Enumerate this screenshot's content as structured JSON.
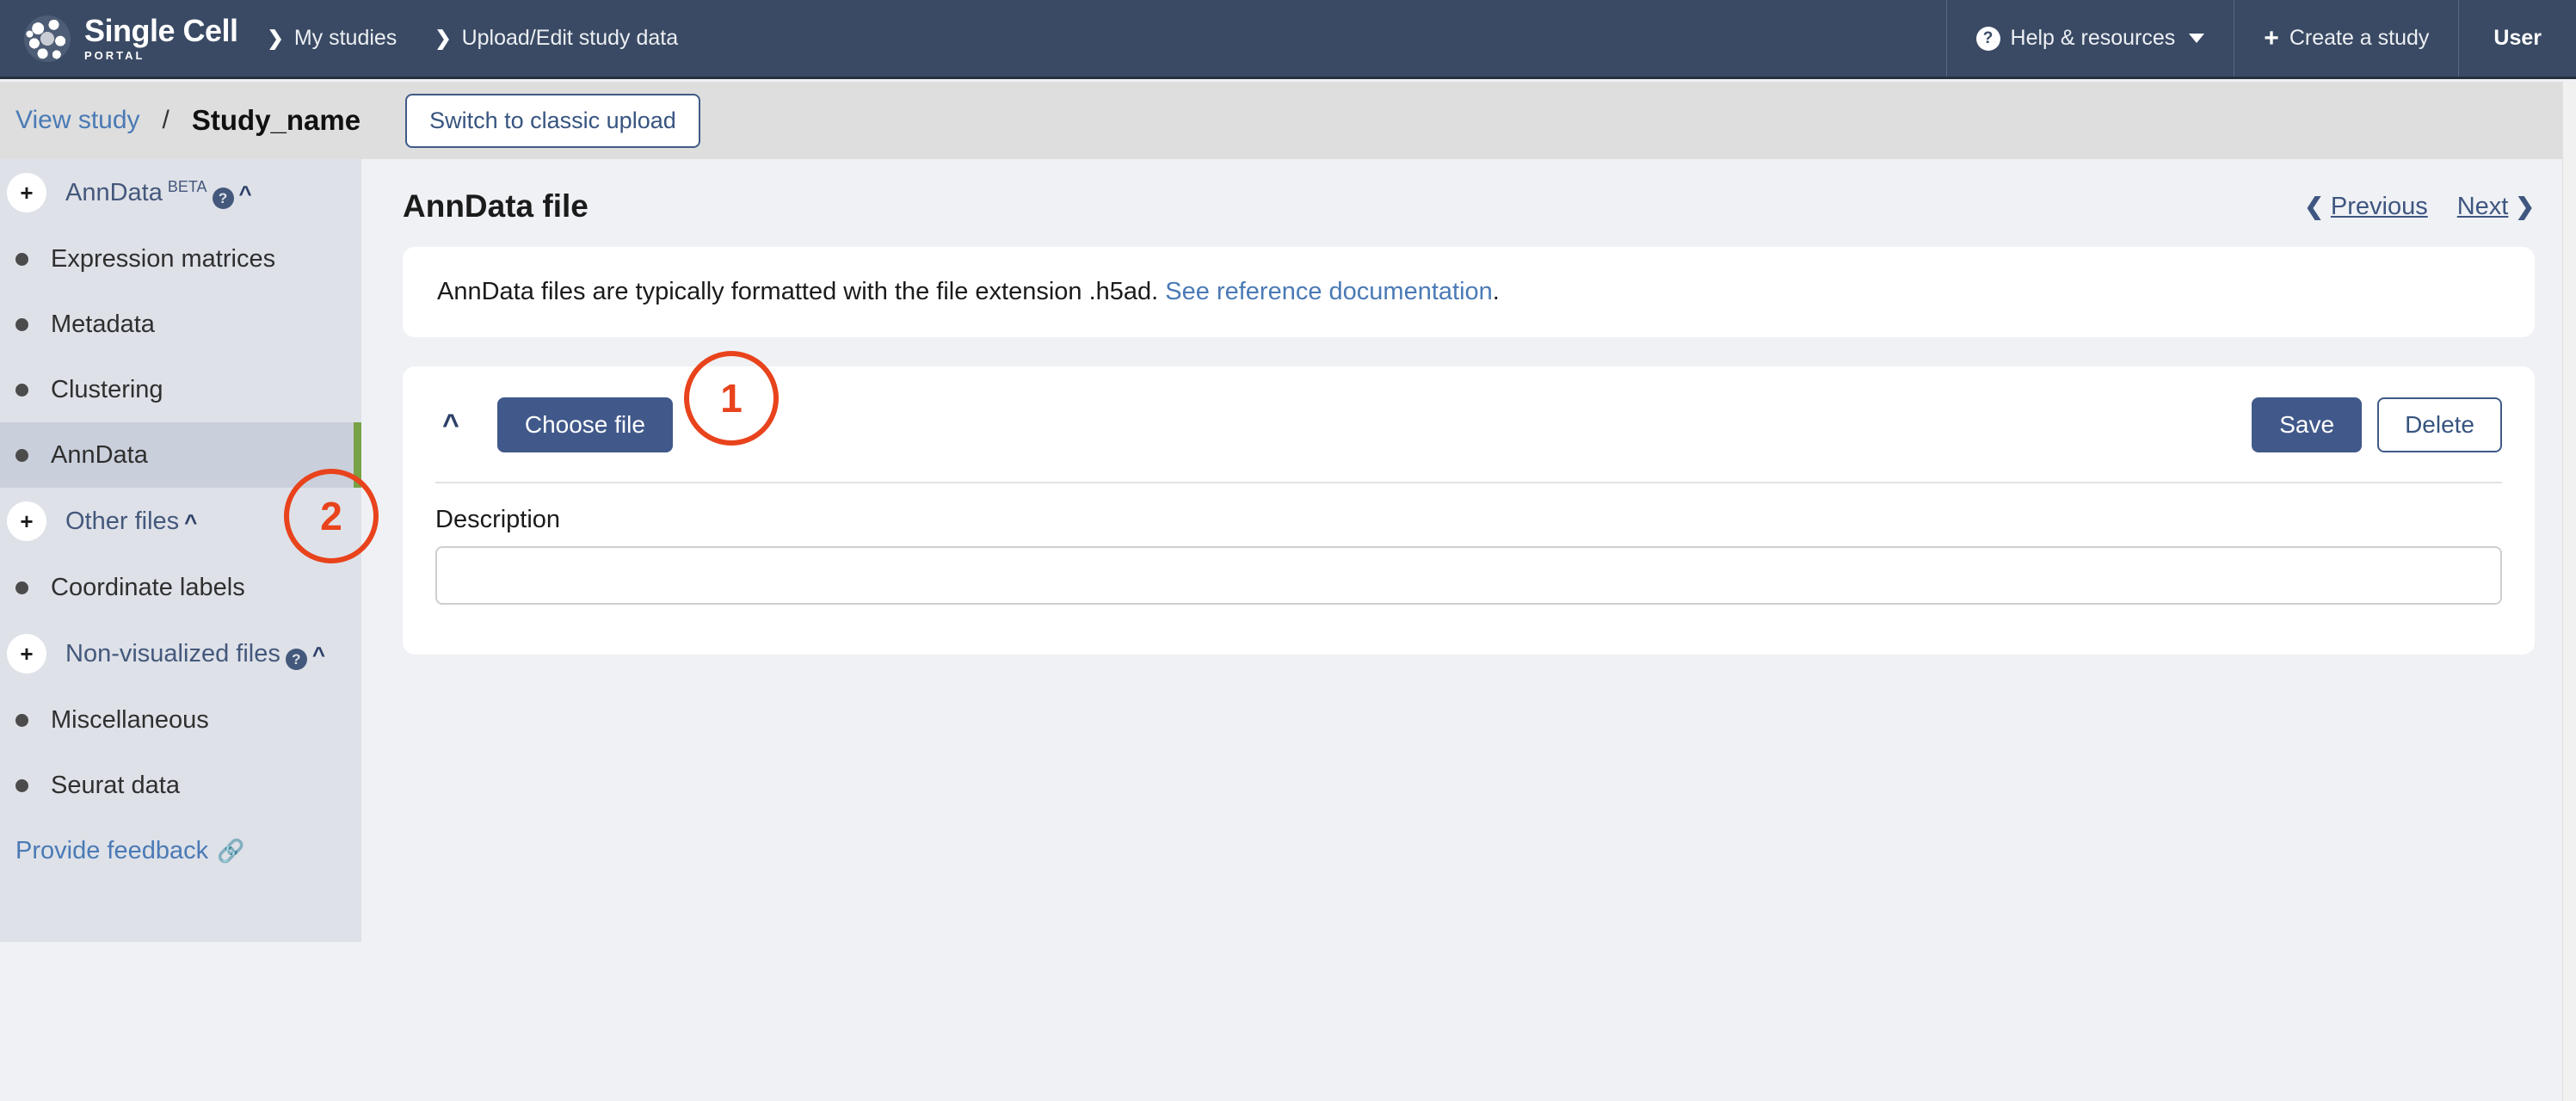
{
  "navbar": {
    "brand": {
      "title": "Single Cell",
      "subtitle": "PORTAL",
      "logo_icon": "cell-cluster-icon"
    },
    "crumbs": [
      {
        "label": "My studies",
        "icon": "chevron-right-icon"
      },
      {
        "label": "Upload/Edit study data",
        "icon": "chevron-right-icon"
      }
    ],
    "help": {
      "label": "Help & resources",
      "icon": "question-circle-icon",
      "caret": "chevron-down-icon"
    },
    "create": {
      "label": "Create a study",
      "icon": "plus-icon"
    },
    "user": {
      "label": "User"
    }
  },
  "subheader": {
    "view_study": "View study",
    "separator": "/",
    "study_name": "Study_name",
    "switch_button": "Switch to classic upload"
  },
  "sidebar": {
    "groups": [
      {
        "label": "AnnData",
        "badge": "BETA",
        "has_help": true,
        "chevron": "chevron-up-icon",
        "plus": "+",
        "items": [
          {
            "label": "Expression matrices",
            "selected": false
          },
          {
            "label": "Metadata",
            "selected": false
          },
          {
            "label": "Clustering",
            "selected": false
          },
          {
            "label": "AnnData",
            "selected": true
          }
        ]
      },
      {
        "label": "Other files",
        "badge": "",
        "has_help": false,
        "chevron": "chevron-up-icon",
        "plus": "+",
        "items": [
          {
            "label": "Coordinate labels",
            "selected": false
          }
        ]
      },
      {
        "label": "Non-visualized files",
        "badge": "",
        "has_help": true,
        "chevron": "chevron-up-icon",
        "plus": "+",
        "items": [
          {
            "label": "Miscellaneous",
            "selected": false
          },
          {
            "label": "Seurat data",
            "selected": false
          }
        ]
      }
    ],
    "feedback": {
      "label": "Provide feedback",
      "icon": "external-link-icon"
    },
    "selected_accent_color": "#78a246"
  },
  "main": {
    "page_title": "AnnData file",
    "pager": {
      "previous": "Previous",
      "next": "Next",
      "prev_icon": "chevron-left-icon",
      "next_icon": "chevron-right-icon"
    },
    "info": {
      "text_before": "AnnData files are typically formatted with the file extension .h5ad. ",
      "link": "See reference documentation",
      "text_after": "."
    },
    "file_form": {
      "collapse_icon": "chevron-up-icon",
      "choose_file_label": "Choose file",
      "save_label": "Save",
      "delete_label": "Delete",
      "description_label": "Description",
      "description_value": "",
      "description_placeholder": ""
    }
  },
  "annotations": [
    {
      "id": "1",
      "label": "1"
    },
    {
      "id": "2",
      "label": "2"
    }
  ],
  "colors": {
    "navbar_bg": "#3a4a64",
    "subheader_bg": "#dedede",
    "sidebar_bg": "#dee1e8",
    "page_bg": "#eff1f5",
    "primary_button": "#41598a",
    "link": "#4a7ab5",
    "accent_green": "#78a246",
    "annotation": "#e8431c"
  }
}
